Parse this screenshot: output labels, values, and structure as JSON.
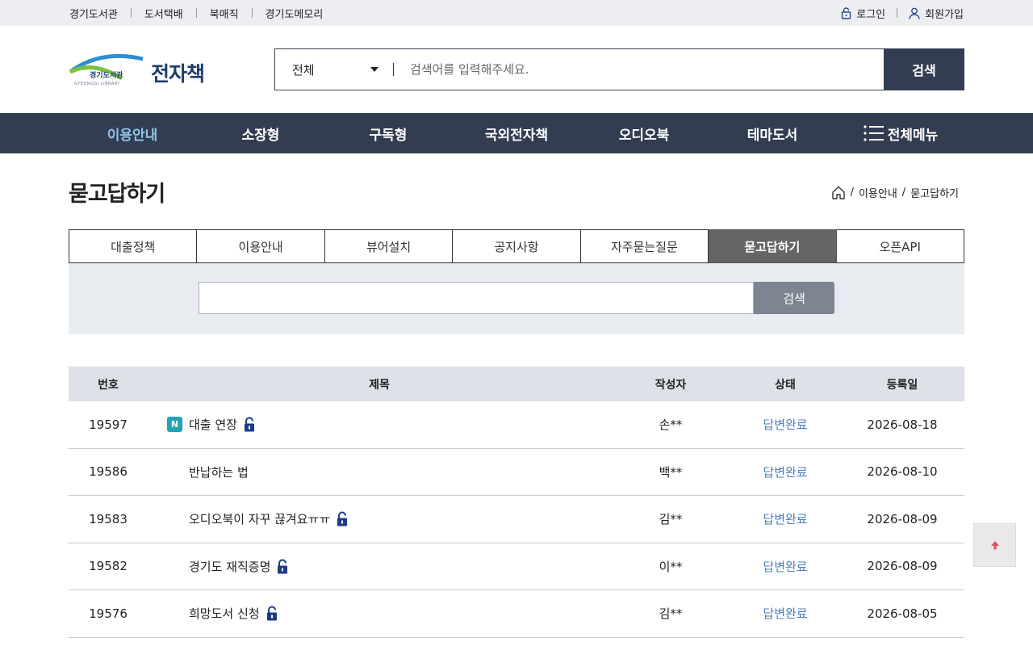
{
  "topbar": {
    "links": [
      "경기도서관",
      "도서택배",
      "북매직",
      "경기도메모리"
    ],
    "login": "로그인",
    "signup": "회원가입"
  },
  "header": {
    "logo_text": "경기도서관",
    "logo_sub": "GYEONGGI LIBRARY",
    "brand": "전자책",
    "search_scope": "전체",
    "search_placeholder": "검색어를 입력해주세요.",
    "search_button": "검색"
  },
  "nav": {
    "items": [
      "이용안내",
      "소장형",
      "구독형",
      "국외전자책",
      "오디오북",
      "테마도서"
    ],
    "all_menu": "전체메뉴",
    "active": "이용안내"
  },
  "page": {
    "title": "묻고답하기",
    "breadcrumb": [
      "이용안내",
      "묻고답하기"
    ]
  },
  "tabs": {
    "items": [
      "대출정책",
      "이용안내",
      "뷰어설치",
      "공지사항",
      "자주묻는질문",
      "묻고답하기",
      "오픈API"
    ],
    "active": "묻고답하기"
  },
  "qna_search": {
    "button": "검색",
    "value": ""
  },
  "table": {
    "headers": {
      "num": "번호",
      "title": "제목",
      "author": "작성자",
      "status": "상태",
      "date": "등록일"
    },
    "rows": [
      {
        "num": "19597",
        "badge": "N",
        "title": "대출 연장",
        "locked": true,
        "author": "손**",
        "status": "답변완료",
        "date": "2026-08-18"
      },
      {
        "num": "19586",
        "badge": "",
        "title": "반납하는 법",
        "locked": false,
        "author": "백**",
        "status": "답변완료",
        "date": "2026-08-10"
      },
      {
        "num": "19583",
        "badge": "",
        "title": "오디오북이 자꾸 끊겨요ㅠㅠ",
        "locked": true,
        "author": "김**",
        "status": "답변완료",
        "date": "2026-08-09"
      },
      {
        "num": "19582",
        "badge": "",
        "title": "경기도 재직증명",
        "locked": true,
        "author": "이**",
        "status": "답변완료",
        "date": "2026-08-09"
      },
      {
        "num": "19576",
        "badge": "",
        "title": "희망도서 신청",
        "locked": true,
        "author": "김**",
        "status": "답변완료",
        "date": "2026-08-05"
      }
    ]
  },
  "colors": {
    "nav_bg": "#333d52",
    "active_nav": "#8fc3ea",
    "status": "#4a7fbe",
    "badge": "#23a3b3",
    "lock": "#1e3a8a"
  },
  "icons": [
    "lock-icon",
    "user-icon",
    "home-icon",
    "menu-icon",
    "arrow-up-icon",
    "caret-down-icon"
  ]
}
